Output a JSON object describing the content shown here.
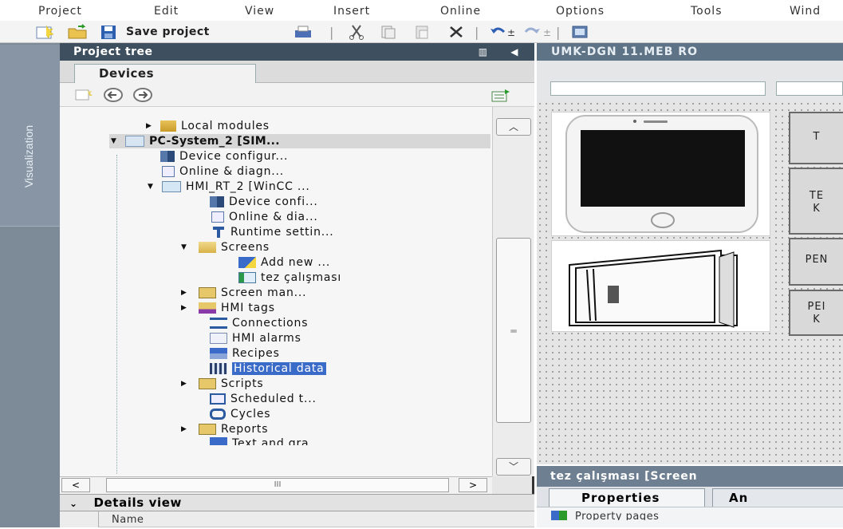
{
  "menu": [
    "Project",
    "Edit",
    "View",
    "Insert",
    "Online",
    "Options",
    "Tools",
    "Wind"
  ],
  "toolbar": {
    "save_label": "Save project"
  },
  "sidebar": {
    "tab_label": "Visualization"
  },
  "project_tree": {
    "title": "Project tree",
    "devices_tab": "Devices",
    "items": [
      {
        "label": "Local modules",
        "icon": "folder-icon"
      },
      {
        "label": "PC-System_2 [SIM...",
        "icon": "pc-station-icon"
      },
      {
        "label": "Device configur...",
        "icon": "device-config-icon"
      },
      {
        "label": "Online & diagn...",
        "icon": "online-diagnostics-icon"
      },
      {
        "label": "HMI_RT_2 [WinCC ...",
        "icon": "hmi-runtime-icon"
      },
      {
        "label": "Device confi...",
        "icon": "device-config-icon"
      },
      {
        "label": "Online & dia...",
        "icon": "online-diagnostics-icon"
      },
      {
        "label": "Runtime settin...",
        "icon": "runtime-settings-icon"
      },
      {
        "label": "Screens",
        "icon": "folder-icon"
      },
      {
        "label": "Add new ...",
        "icon": "add-screen-icon"
      },
      {
        "label": "tez çalışması",
        "icon": "screen-icon"
      },
      {
        "label": "Screen man...",
        "icon": "screen-management-icon"
      },
      {
        "label": "HMI tags",
        "icon": "hmi-tags-icon"
      },
      {
        "label": "Connections",
        "icon": "connections-icon"
      },
      {
        "label": "HMI alarms",
        "icon": "alarms-icon"
      },
      {
        "label": "Recipes",
        "icon": "recipes-icon"
      },
      {
        "label": "Historical data",
        "icon": "historical-data-icon"
      },
      {
        "label": "Scripts",
        "icon": "scripts-icon"
      },
      {
        "label": "Scheduled t...",
        "icon": "scheduled-tasks-icon"
      },
      {
        "label": "Cycles",
        "icon": "cycles-icon"
      },
      {
        "label": "Reports",
        "icon": "reports-icon"
      },
      {
        "label": "Text and gra...",
        "icon": "text-graphics-icon"
      }
    ]
  },
  "details_view": {
    "title": "Details view",
    "name_col": "Name"
  },
  "editor": {
    "title": "UMK-DGN 11.MEB RO",
    "buttons": [
      "T",
      "TE\nK",
      "PEN",
      "PEI\nK"
    ]
  },
  "inspector": {
    "title": "tez çalışması [Screen",
    "tabs": [
      "Properties",
      "An"
    ],
    "row_label": "Property pages"
  },
  "colors": {
    "tree_header_bg": "#3e4f5f",
    "selection": "#3a6bc8",
    "sidebar_bg": "#7d8a98"
  }
}
